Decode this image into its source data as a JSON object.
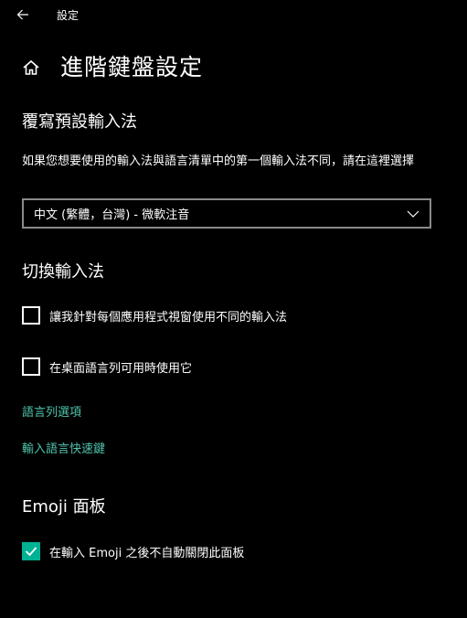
{
  "titlebar": {
    "back_icon": "back-arrow-icon",
    "app_title": "設定"
  },
  "header": {
    "home_icon": "home-icon",
    "title": "進階鍵盤設定"
  },
  "override_section": {
    "title": "覆寫預設輸入法",
    "description": "如果您想要使用的輸入法與語言清單中的第一個輸入法不同，請在這裡選擇",
    "dropdown": {
      "selected": "中文 (繁體，台灣) - 微軟注音",
      "icon": "chevron-down-icon"
    }
  },
  "switch_section": {
    "title": "切換輸入法",
    "checkbox1": {
      "label": "讓我針對每個應用程式視窗使用不同的輸入法",
      "checked": false
    },
    "checkbox2": {
      "label": "在桌面語言列可用時使用它",
      "checked": false
    },
    "link1": "語言列選項",
    "link2": "輸入語言快速鍵"
  },
  "emoji_section": {
    "title": "Emoji 面板",
    "checkbox": {
      "label": "在輸入 Emoji 之後不自動關閉此面板",
      "checked": true
    }
  },
  "colors": {
    "background": "#000000",
    "accent": "#00b294",
    "link": "#4fc3ad",
    "border": "#8a8a8a"
  }
}
